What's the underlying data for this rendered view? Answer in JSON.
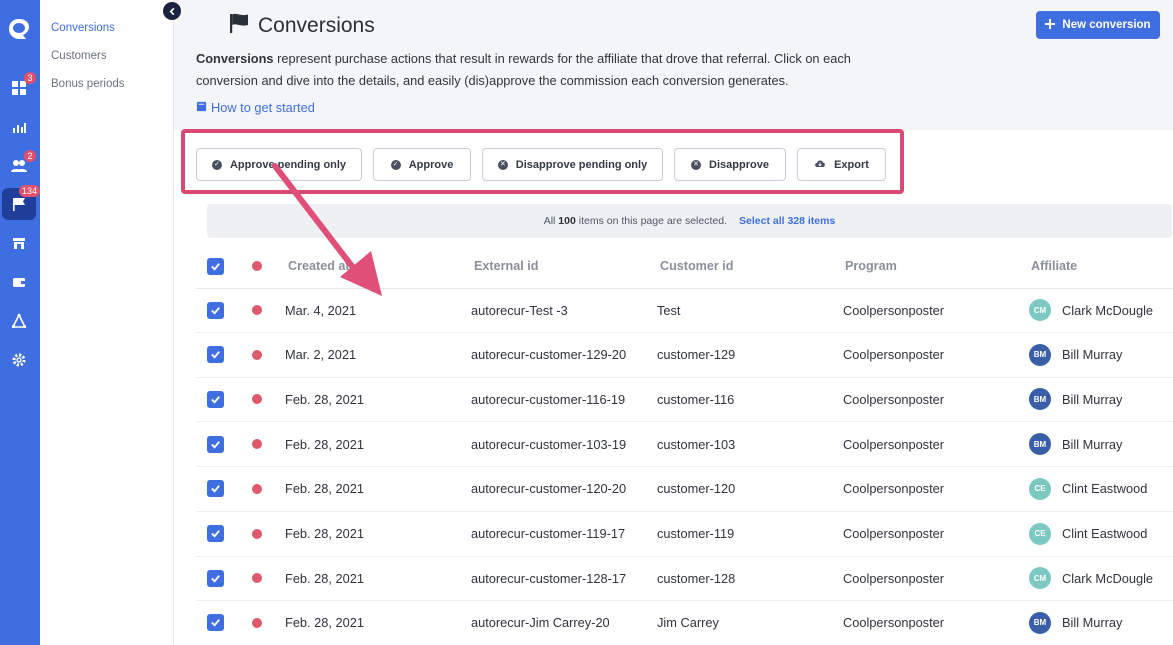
{
  "rail": {
    "badges": {
      "dashboard": "3",
      "affiliates": "2",
      "conversions": "134"
    }
  },
  "subnav": {
    "items": [
      {
        "label": "Conversions",
        "active": true
      },
      {
        "label": "Customers",
        "active": false
      },
      {
        "label": "Bonus periods",
        "active": false
      }
    ]
  },
  "header": {
    "title": "Conversions",
    "new_button": "New conversion",
    "description_bold": "Conversions",
    "description_rest": " represent purchase actions that result in rewards for the affiliate that drove that referral. Click on each conversion and dive into the details, and easily (dis)approve the commission each conversion generates.",
    "howto_link": "How to get started"
  },
  "actions": {
    "approve_pending": "Approve pending only",
    "approve": "Approve",
    "disapprove_pending": "Disapprove pending only",
    "disapprove": "Disapprove",
    "export": "Export"
  },
  "selection": {
    "prefix": "All",
    "count": "100",
    "suffix": "items on this page are selected.",
    "select_all": "Select all 328 items"
  },
  "table": {
    "columns": {
      "created_at": "Created at",
      "external_id": "External id",
      "customer_id": "Customer id",
      "program": "Program",
      "affiliate": "Affiliate"
    },
    "rows": [
      {
        "created_at": "Mar. 4, 2021",
        "external_id": "autorecur-Test -3",
        "customer_id": "Test",
        "program": "Coolpersonposter",
        "initials": "CM",
        "affiliate": "Clark McDougle",
        "avatar_color": "#7cc9c2"
      },
      {
        "created_at": "Mar. 2, 2021",
        "external_id": "autorecur-customer-129-20",
        "customer_id": "customer-129",
        "program": "Coolpersonposter",
        "initials": "BM",
        "affiliate": "Bill Murray",
        "avatar_color": "#3b5ea8"
      },
      {
        "created_at": "Feb. 28, 2021",
        "external_id": "autorecur-customer-116-19",
        "customer_id": "customer-116",
        "program": "Coolpersonposter",
        "initials": "BM",
        "affiliate": "Bill Murray",
        "avatar_color": "#3b5ea8"
      },
      {
        "created_at": "Feb. 28, 2021",
        "external_id": "autorecur-customer-103-19",
        "customer_id": "customer-103",
        "program": "Coolpersonposter",
        "initials": "BM",
        "affiliate": "Bill Murray",
        "avatar_color": "#3b5ea8"
      },
      {
        "created_at": "Feb. 28, 2021",
        "external_id": "autorecur-customer-120-20",
        "customer_id": "customer-120",
        "program": "Coolpersonposter",
        "initials": "CE",
        "affiliate": "Clint Eastwood",
        "avatar_color": "#7cc9c2"
      },
      {
        "created_at": "Feb. 28, 2021",
        "external_id": "autorecur-customer-119-17",
        "customer_id": "customer-119",
        "program": "Coolpersonposter",
        "initials": "CE",
        "affiliate": "Clint Eastwood",
        "avatar_color": "#7cc9c2"
      },
      {
        "created_at": "Feb. 28, 2021",
        "external_id": "autorecur-customer-128-17",
        "customer_id": "customer-128",
        "program": "Coolpersonposter",
        "initials": "CM",
        "affiliate": "Clark McDougle",
        "avatar_color": "#7cc9c2"
      },
      {
        "created_at": "Feb. 28, 2021",
        "external_id": "autorecur-Jim Carrey-20",
        "customer_id": "Jim Carrey",
        "program": "Coolpersonposter",
        "initials": "BM",
        "affiliate": "Bill Murray",
        "avatar_color": "#3b5ea8"
      }
    ]
  },
  "colors": {
    "accent": "#3e6ee0",
    "highlight": "#d94a72",
    "status_dot": "#e0586b"
  }
}
